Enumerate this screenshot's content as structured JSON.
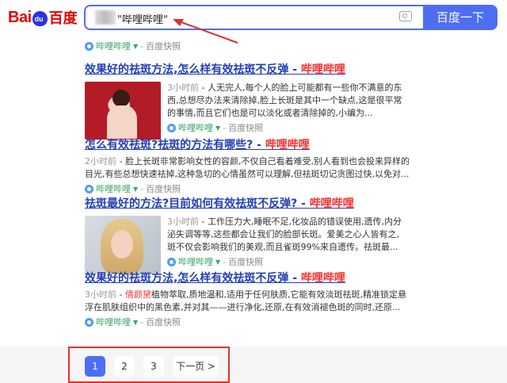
{
  "header": {
    "logo_text_left": "Bai",
    "logo_text_right": "百度",
    "search_value": "\"哔哩哔哩\"",
    "search_button": "百度一下"
  },
  "top_snippet": {
    "source": "哔哩哔哩",
    "snapshot": "百度快照"
  },
  "results": [
    {
      "title_prefix": "效果好的祛斑方法,怎么样有效祛斑不反弹 - ",
      "title_site": "哔哩哔哩",
      "time": "3小时前",
      "text": " - 人无完人,每个人的脸上可能都有一些你不满意的东西,总想尽办法来清除掉,脸上长斑是其中一个缺点,这是很平常的事情,而且它们也是可以淡化或者清除掉的,小编为...",
      "source": "哔哩哔哩",
      "snapshot": "百度快照"
    },
    {
      "title_prefix": "怎么有效祛斑?祛斑的方法有哪些? - ",
      "title_site": "哔哩哔哩",
      "time": "2小时前",
      "text": " - 脸上长斑非常影响女性的容颜,不仅自己看着难受,别人看到也会投来异样的目光,有些总想快速祛掉,这种急切的心情虽然可以理解,但祛斑切记贪图过快,以免对...",
      "source": "哔哩哔哩",
      "snapshot": "百度快照"
    },
    {
      "title_prefix": "祛斑最好的方法?目前如何有效祛斑不反弹? - ",
      "title_site": "哔哩哔哩",
      "time": "3小时前",
      "text": " - 工作压力大,睡眠不足,化妆品的错误使用,遗传,内分泌失调等等,这些都会让我们的脸部长斑。爱美之心人皆有之,斑不仅会影响我们的美观,而且雀斑99%来自遗传。祛斑最...",
      "source": "哔哩哔哩",
      "snapshot": "百度快照"
    },
    {
      "title_prefix": "效果好的祛斑方法,怎么样有效祛斑不反弹 - ",
      "title_site": "哔哩哔哩",
      "time": "3小时前",
      "text_a": " - ",
      "hl1": "倩颜黛",
      "text_b": "植物萃取,质地温和,适用于任何肤质,它能有效淡斑祛斑,精准锁定悬浮在肌肤组织中的黑色素,并对其——进行净化,还原,在有效消褪色斑的同时,还原...",
      "source": "哔哩哔哩",
      "snapshot": "百度快照"
    }
  ],
  "pagination": {
    "pages": [
      "1",
      "2",
      "3"
    ],
    "active": "1",
    "next": "下一页 >"
  }
}
